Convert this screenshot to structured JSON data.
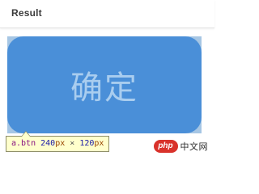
{
  "header": {
    "title": "Result"
  },
  "button": {
    "label": "确定",
    "color": "#4a8fd8",
    "label_color": "#a9cdef"
  },
  "tooltip": {
    "selector": "a.btn",
    "width_value": "240",
    "width_unit": "px",
    "separator": "×",
    "height_value": "120",
    "height_unit": "px"
  },
  "watermark": {
    "logo_text": "php",
    "site_text": "中文网"
  }
}
